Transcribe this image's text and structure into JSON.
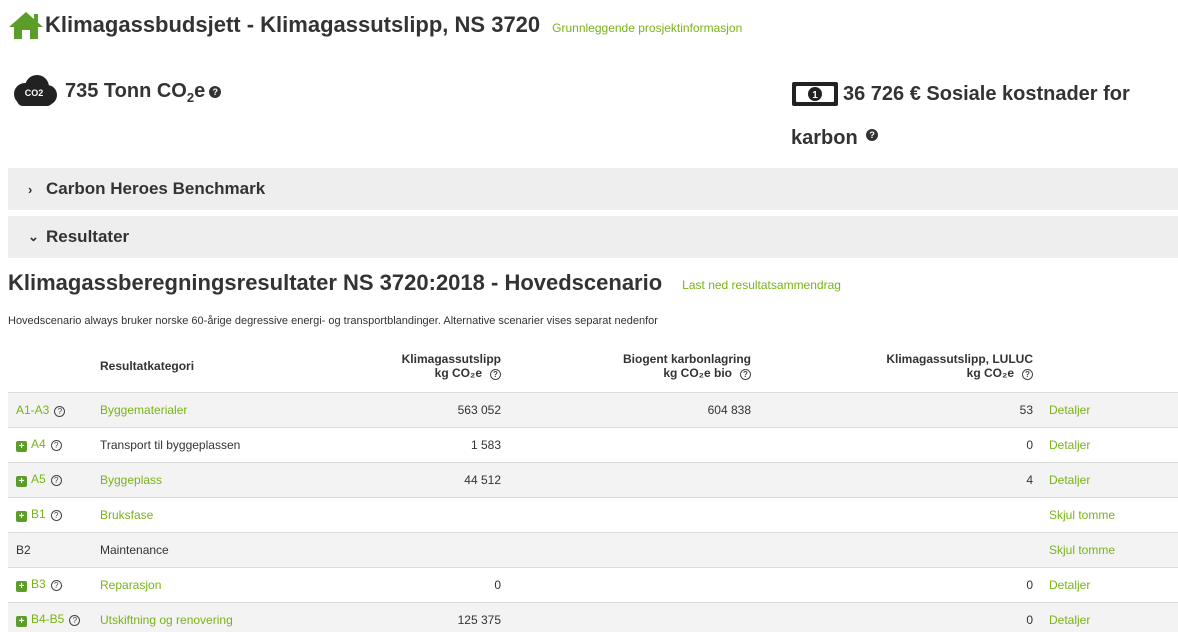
{
  "header": {
    "title": "Klimagassbudsjett - Klimagassutslipp, NS 3720",
    "info_link": "Grunnleggende prosjektinformasjon"
  },
  "kpis": {
    "co2_badge": "CO2",
    "emissions": {
      "value": "735 Tonn CO",
      "sub": "2",
      "suffix": "e"
    },
    "social_cost": {
      "line1": "36 726 € Sosiale kostnader for",
      "line2": "karbon"
    }
  },
  "accordions": [
    {
      "label": "Carbon Heroes Benchmark",
      "state": "collapsed"
    },
    {
      "label": "Resultater",
      "state": "expanded"
    }
  ],
  "results": {
    "title": "Klimagassberegningsresultater NS 3720:2018 - Hovedscenario",
    "download_link": "Last ned resultatsammendrag",
    "note": "Hovedscenario always bruker norske 60-årige degressive energi- og transportblandinger. Alternative scenarier vises separat nedenfor",
    "columns": {
      "category": "Resultatkategori",
      "emissions": {
        "title": "Klimagassutslipp",
        "unit": "kg CO₂e"
      },
      "biogenic": {
        "title": "Biogent karbonlagring",
        "unit": "kg CO₂e bio"
      },
      "luluc": {
        "title": "Klimagassutslipp, LULUC",
        "unit": "kg CO₂e"
      }
    },
    "rows": [
      {
        "code": "A1-A3",
        "expand": false,
        "help": true,
        "category": "Byggematerialer",
        "cat_link": true,
        "emissions": "563 052",
        "biogenic": "604 838",
        "luluc": "53",
        "action": "Detaljer"
      },
      {
        "code": "A4",
        "expand": true,
        "help": true,
        "category": "Transport til byggeplassen",
        "cat_link": false,
        "emissions": "1 583",
        "biogenic": "",
        "luluc": "0",
        "action": "Detaljer"
      },
      {
        "code": "A5",
        "expand": true,
        "help": true,
        "category": "Byggeplass",
        "cat_link": true,
        "emissions": "44 512",
        "biogenic": "",
        "luluc": "4",
        "action": "Detaljer"
      },
      {
        "code": "B1",
        "expand": true,
        "help": true,
        "category": "Bruksfase",
        "cat_link": true,
        "emissions": "",
        "biogenic": "",
        "luluc": "",
        "action": "Skjul tomme"
      },
      {
        "code": "B2",
        "expand": false,
        "help": false,
        "category": "Maintenance",
        "cat_link": false,
        "emissions": "",
        "biogenic": "",
        "luluc": "",
        "action": "Skjul tomme"
      },
      {
        "code": "B3",
        "expand": true,
        "help": true,
        "category": "Reparasjon",
        "cat_link": true,
        "emissions": "0",
        "biogenic": "",
        "luluc": "0",
        "action": "Detaljer"
      },
      {
        "code": "B4-B5",
        "expand": true,
        "help": true,
        "category": "Utskiftning og renovering",
        "cat_link": true,
        "emissions": "125 375",
        "biogenic": "",
        "luluc": "0",
        "action": "Detaljer"
      }
    ]
  },
  "colors": {
    "accent": "#7ab317",
    "icon_green": "#5c9c28",
    "band": "#eeeeee"
  }
}
